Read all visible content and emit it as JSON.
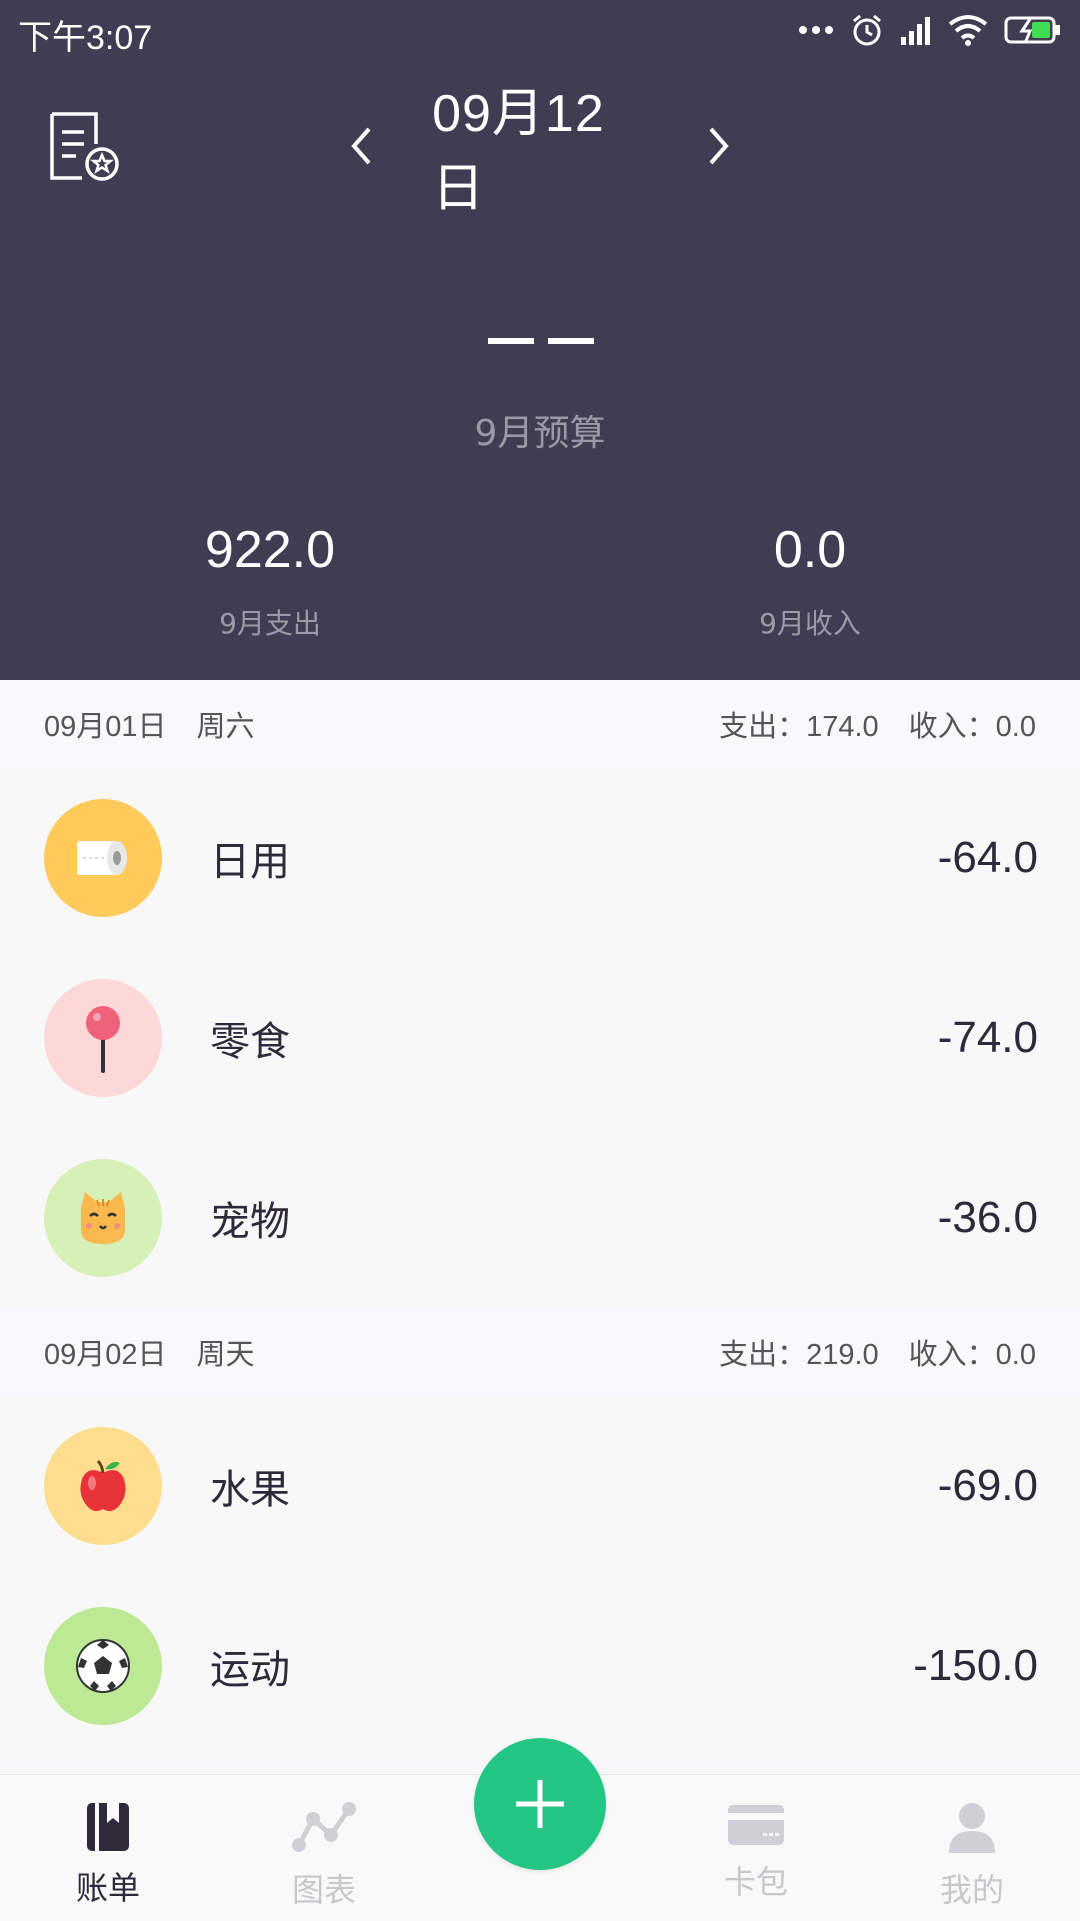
{
  "status_bar": {
    "time": "下午3:07"
  },
  "header": {
    "date": "09月12日",
    "budget_value": "——",
    "budget_label": "9月预算",
    "expense_value": "922.0",
    "expense_label": "9月支出",
    "income_value": "0.0",
    "income_label": "9月收入"
  },
  "days": [
    {
      "date": "09月01日",
      "weekday": "周六",
      "expense": "支出：174.0",
      "income": "收入：0.0",
      "items": [
        {
          "name": "日用",
          "amount": "-64.0",
          "icon": "toilet-paper-icon",
          "color": "#fecb5a"
        },
        {
          "name": "零食",
          "amount": "-74.0",
          "icon": "lollipop-icon",
          "color": "#fdd8d8"
        },
        {
          "name": "宠物",
          "amount": "-36.0",
          "icon": "cat-icon",
          "color": "#d6f0b8"
        }
      ]
    },
    {
      "date": "09月02日",
      "weekday": "周天",
      "expense": "支出：219.0",
      "income": "收入：0.0",
      "items": [
        {
          "name": "水果",
          "amount": "-69.0",
          "icon": "apple-icon",
          "color": "#fedd8e"
        },
        {
          "name": "运动",
          "amount": "-150.0",
          "icon": "soccer-ball-icon",
          "color": "#bde894"
        }
      ]
    }
  ],
  "bottom_nav": {
    "tabs": [
      {
        "label": "账单",
        "icon": "bill-book-icon",
        "active": true
      },
      {
        "label": "图表",
        "icon": "chart-icon",
        "active": false
      },
      {
        "label": "卡包",
        "icon": "card-icon",
        "active": false
      },
      {
        "label": "我的",
        "icon": "profile-icon",
        "active": false
      }
    ],
    "add_icon": "plus-icon"
  },
  "colors": {
    "header_bg": "#403c51",
    "accent": "#24c685"
  }
}
